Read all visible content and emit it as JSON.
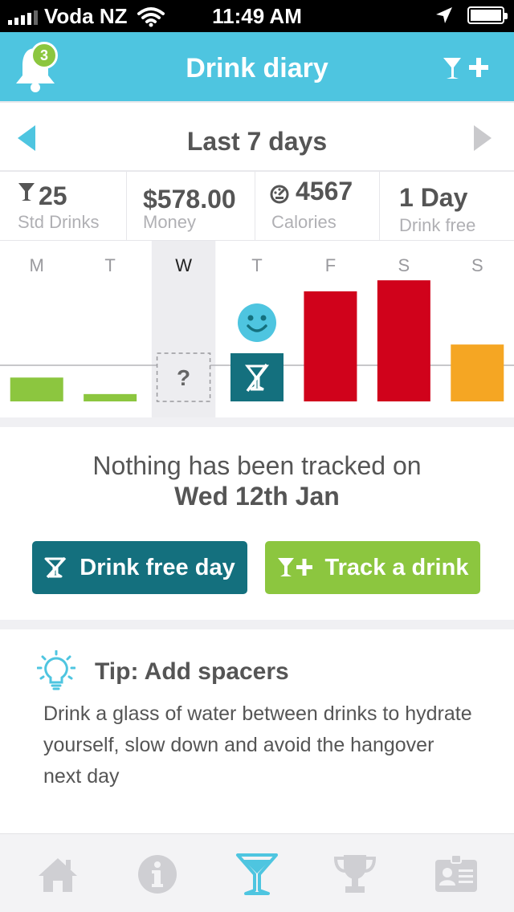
{
  "status_bar": {
    "carrier": "Voda NZ",
    "time": "11:49 AM"
  },
  "nav": {
    "title": "Drink diary",
    "notification_count": "3"
  },
  "period": {
    "label": "Last 7 days"
  },
  "stats": [
    {
      "value": "25",
      "label": "Std Drinks"
    },
    {
      "value": "$578.00",
      "label": "Money"
    },
    {
      "value": "4567",
      "label": "Calories"
    },
    {
      "value": "1 Day",
      "label": "Drink free"
    }
  ],
  "chart_data": {
    "type": "bar",
    "categories": [
      "M",
      "T",
      "W",
      "T",
      "F",
      "S",
      "S"
    ],
    "values": [
      1.3,
      0.4,
      null,
      0,
      6,
      6.6,
      3.1
    ],
    "selected_index": 2,
    "unknown_label": "?",
    "colors": [
      "#8cc63f",
      "#8cc63f",
      "#d6d6da",
      "#14707e",
      "#d0021b",
      "#d0021b",
      "#f5a623"
    ]
  },
  "message": {
    "line1": "Nothing has been tracked on",
    "line2": "Wed 12th Jan"
  },
  "buttons": {
    "drink_free": "Drink free day",
    "track": "Track a drink"
  },
  "tip": {
    "title": "Tip: Add spacers",
    "body": "Drink a glass of water between drinks to hydrate yourself, slow down and avoid the hangover next day"
  },
  "tabs": [
    "home-icon",
    "info-icon",
    "cocktail-icon",
    "trophy-icon",
    "profile-card-icon"
  ],
  "colors": {
    "accent": "#4ec5e0",
    "teal": "#14707e",
    "green": "#8cc63f",
    "red": "#d0021b",
    "orange": "#f5a623"
  }
}
